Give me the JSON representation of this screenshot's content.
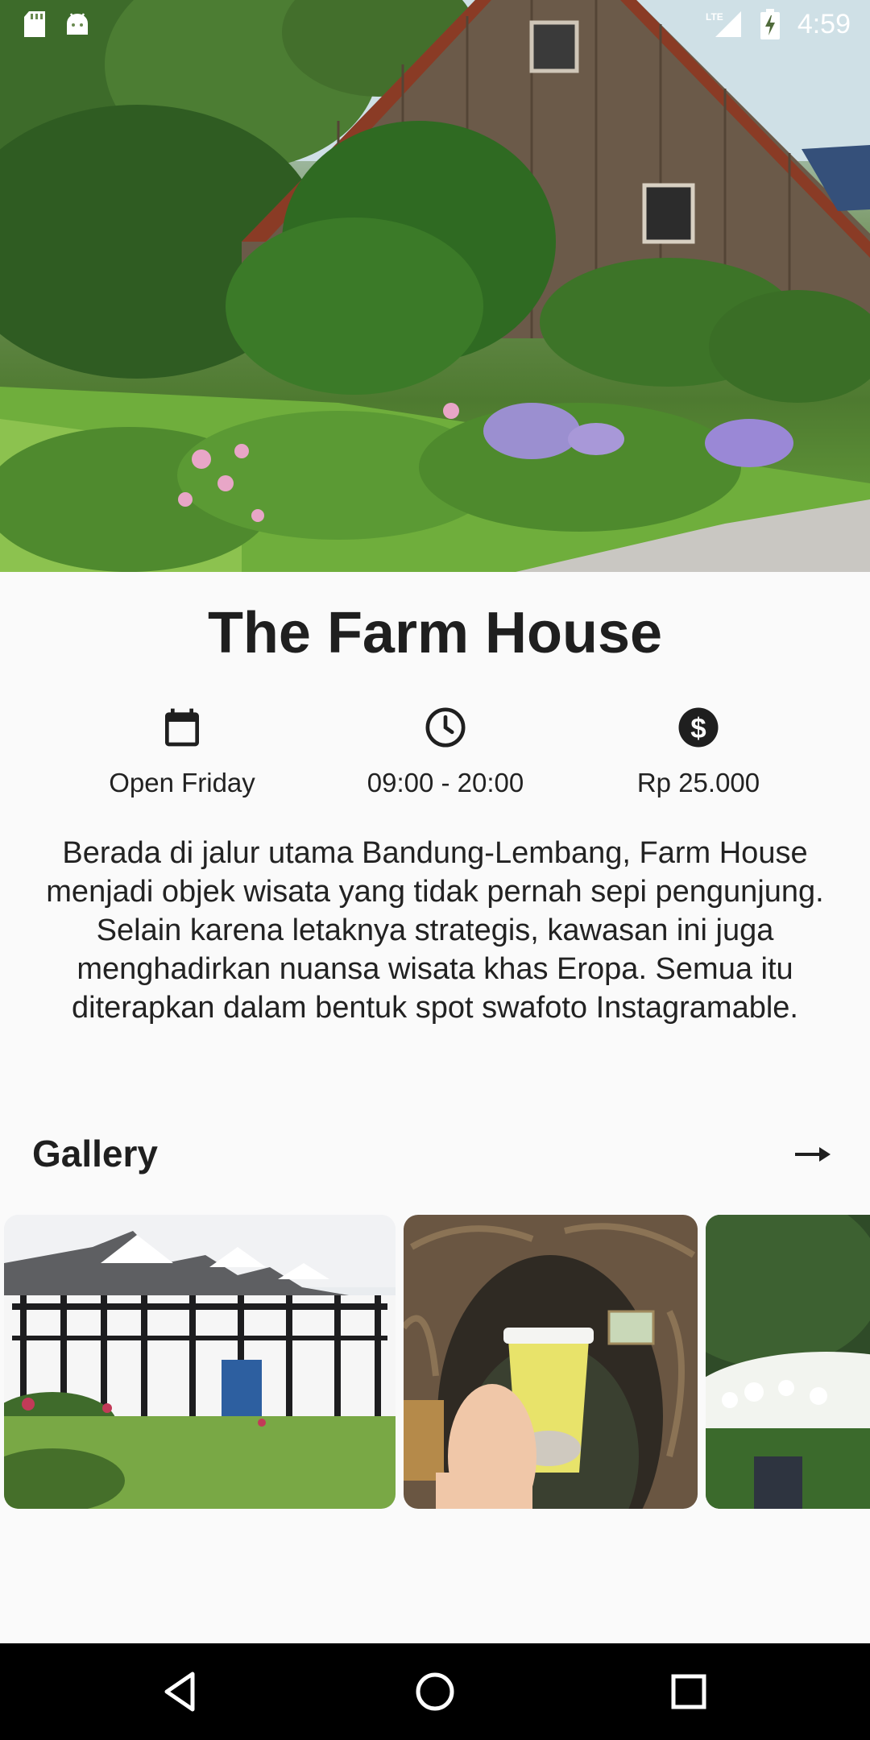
{
  "status_bar": {
    "time": "4:59",
    "network": "LTE",
    "left_icons": [
      "sd-card-icon",
      "android-icon"
    ],
    "right_icons": [
      "lte-signal-icon",
      "battery-charging-icon"
    ]
  },
  "hero": {
    "image": "farm-house-photo"
  },
  "place": {
    "title": "The Farm House",
    "info": [
      {
        "icon": "calendar-icon",
        "label": "Open Friday"
      },
      {
        "icon": "clock-icon",
        "label": "09:00 - 20:00"
      },
      {
        "icon": "dollar-icon",
        "label": "Rp 25.000"
      }
    ],
    "description": "Berada di jalur utama Bandung-Lembang, Farm House menjadi objek wisata yang tidak pernah sepi pengunjung. Selain karena letaknya strategis, kawasan ini juga menghadirkan nuansa wisata khas Eropa. Semua itu diterapkan dalam bentuk spot swafoto Instagramable."
  },
  "gallery": {
    "title": "Gallery",
    "arrow_icon": "arrow-right-icon",
    "photos": [
      "tudor-house-photo",
      "farmhouse-coffee-cup-photo",
      "garden-flowers-photo"
    ]
  },
  "nav_bar": {
    "buttons": [
      "back-icon",
      "home-icon",
      "recents-icon"
    ]
  },
  "colors": {
    "background": "#fafafa",
    "text": "#1f1f1f",
    "nav_bar": "#000000"
  }
}
